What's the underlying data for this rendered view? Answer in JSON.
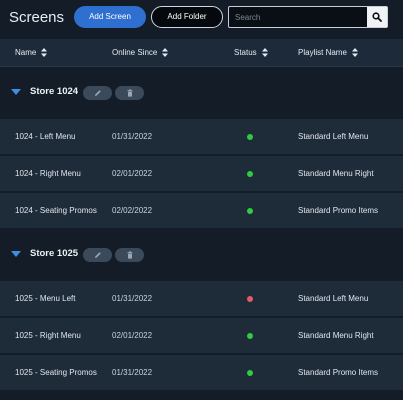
{
  "header": {
    "title": "Screens",
    "add_screen_label": "Add Screen",
    "add_folder_label": "Add Folder",
    "search_placeholder": "Search"
  },
  "columns": {
    "name": "Name",
    "online_since": "Online Since",
    "status": "Status",
    "playlist": "Playlist Name"
  },
  "colors": {
    "accent": "#2f6fd0",
    "status_online": "#2ecc40",
    "status_offline": "#e65a67"
  },
  "groups": [
    {
      "name": "Store 1024",
      "rows": [
        {
          "name": "1024 - Left Menu",
          "online_since": "01/31/2022",
          "status": "online",
          "playlist": "Standard Left Menu"
        },
        {
          "name": "1024 - Right Menu",
          "online_since": "02/01/2022",
          "status": "online",
          "playlist": "Standard Menu Right"
        },
        {
          "name": "1024 - Seating Promos",
          "online_since": "02/02/2022",
          "status": "online",
          "playlist": "Standard Promo Items"
        }
      ]
    },
    {
      "name": "Store 1025",
      "rows": [
        {
          "name": "1025 - Menu Left",
          "online_since": "01/31/2022",
          "status": "offline",
          "playlist": "Standard Left Menu"
        },
        {
          "name": "1025 - Right Menu",
          "online_since": "02/01/2022",
          "status": "online",
          "playlist": "Standard Menu Right"
        },
        {
          "name": "1025 - Seating Promos",
          "online_since": "01/31/2022",
          "status": "online",
          "playlist": "Standard Promo Items"
        }
      ]
    }
  ]
}
